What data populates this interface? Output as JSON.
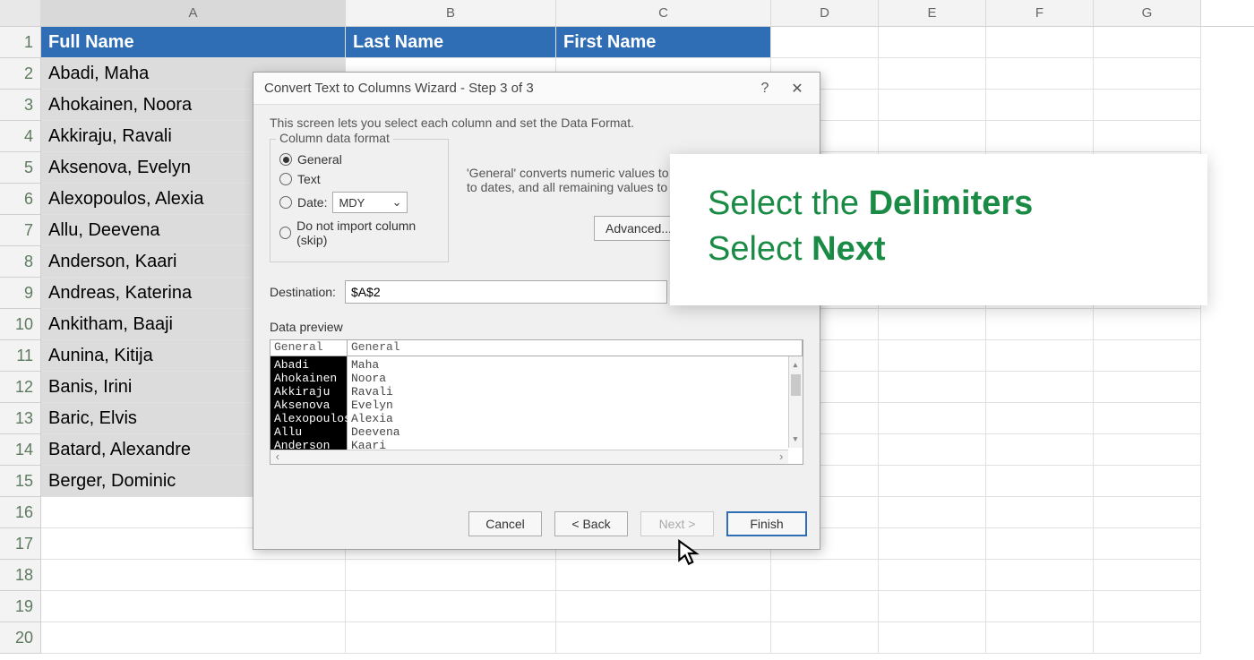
{
  "sheet": {
    "col_letters": [
      "",
      "A",
      "B",
      "C",
      "D",
      "E",
      "F",
      "G"
    ],
    "headers": {
      "A": "Full Name",
      "B": "Last Name",
      "C": "First Name"
    },
    "rows_data": [
      "Abadi, Maha",
      "Ahokainen, Noora",
      "Akkiraju, Ravali",
      "Aksenova, Evelyn",
      "Alexopoulos, Alexia",
      "Allu, Deevena",
      "Anderson, Kaari",
      "Andreas, Katerina",
      "Ankitham, Baaji",
      "Aunina, Kitija",
      "Banis, Irini",
      "Baric, Elvis",
      "Batard, Alexandre",
      "Berger, Dominic"
    ],
    "empty_count": 5
  },
  "dialog": {
    "title": "Convert Text to Columns Wizard - Step 3 of 3",
    "desc": "This screen lets you select each column and set the Data Format.",
    "group_title": "Column data format",
    "radios": {
      "general": "General",
      "text": "Text",
      "date": "Date:",
      "skip": "Do not import column (skip)"
    },
    "date_fmt": "MDY",
    "format_help": "'General' converts numeric values to numbers, date values to dates, and all remaining values to text.",
    "advanced": "Advanced...",
    "dest_label": "Destination:",
    "dest_value": "$A$2",
    "preview_label": "Data preview",
    "preview_headers": [
      "General",
      "General"
    ],
    "preview_col1": [
      "Abadi",
      "Ahokainen",
      "Akkiraju",
      "Aksenova",
      "Alexopoulos",
      "Allu",
      "Anderson"
    ],
    "preview_col2": [
      "Maha",
      "Noora",
      "Ravali",
      "Evelyn",
      "Alexia",
      "Deevena",
      "Kaari"
    ],
    "buttons": {
      "cancel": "Cancel",
      "back": "< Back",
      "next": "Next >",
      "finish": "Finish"
    }
  },
  "overlay": {
    "line1a": "Select the ",
    "line1b": "Delimiters",
    "line2a": "Select ",
    "line2b": "Next"
  }
}
